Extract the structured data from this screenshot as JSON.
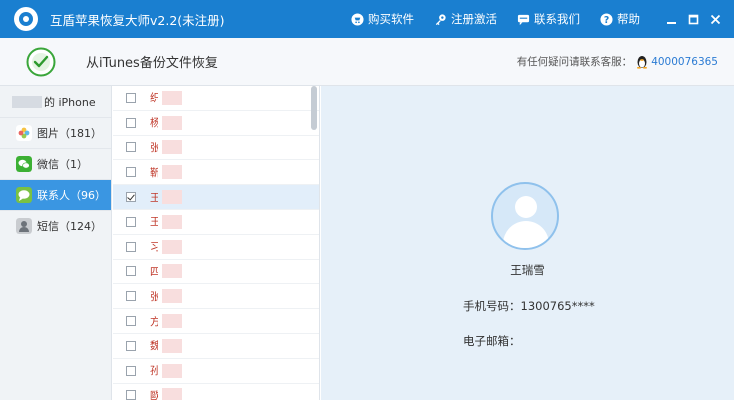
{
  "titlebar": {
    "title": "互盾苹果恢复大师v2.2(未注册)",
    "menu": [
      {
        "label": "购买软件",
        "icon": "cart-icon"
      },
      {
        "label": "注册激活",
        "icon": "key-icon"
      },
      {
        "label": "联系我们",
        "icon": "chat-icon"
      },
      {
        "label": "帮助",
        "icon": "help-icon"
      }
    ]
  },
  "header": {
    "title": "从iTunes备份文件恢复",
    "support_label": "有任何疑问请联系客服：",
    "support_phone": "4000076365"
  },
  "sidebar": {
    "device_label": "的 iPhone",
    "items": [
      {
        "label": "图片（181）",
        "icon": "photos-icon",
        "color": "#f2a33a"
      },
      {
        "label": "微信（1）",
        "icon": "wechat-icon",
        "color": "#3cb034"
      },
      {
        "label": "联系人（96）",
        "icon": "contacts-icon",
        "color": "#7ac143"
      },
      {
        "label": "短信（124）",
        "icon": "sms-icon",
        "color": "#8a8f96"
      }
    ]
  },
  "contacts": [
    {
      "initial": "织",
      "checked": false
    },
    {
      "initial": "杨",
      "checked": false
    },
    {
      "initial": "张",
      "checked": false
    },
    {
      "initial": "靳",
      "checked": false
    },
    {
      "initial": "王",
      "checked": true
    },
    {
      "initial": "王",
      "checked": false
    },
    {
      "initial": "习",
      "checked": false
    },
    {
      "initial": "四",
      "checked": false
    },
    {
      "initial": "张",
      "checked": false
    },
    {
      "initial": "方",
      "checked": false
    },
    {
      "initial": "魏",
      "checked": false
    },
    {
      "initial": "孙",
      "checked": false
    },
    {
      "initial": "歐",
      "checked": false
    }
  ],
  "detail": {
    "name": "王瑞雪",
    "phone_label": "手机号码：",
    "phone_value": "1300765****",
    "email_label": "电子邮箱："
  },
  "colors": {
    "titlebar": "#1a7fd0",
    "active_nav": "#3a96e2",
    "detail_bg": "#e6f0f9",
    "contact_text": "#c0392b"
  }
}
